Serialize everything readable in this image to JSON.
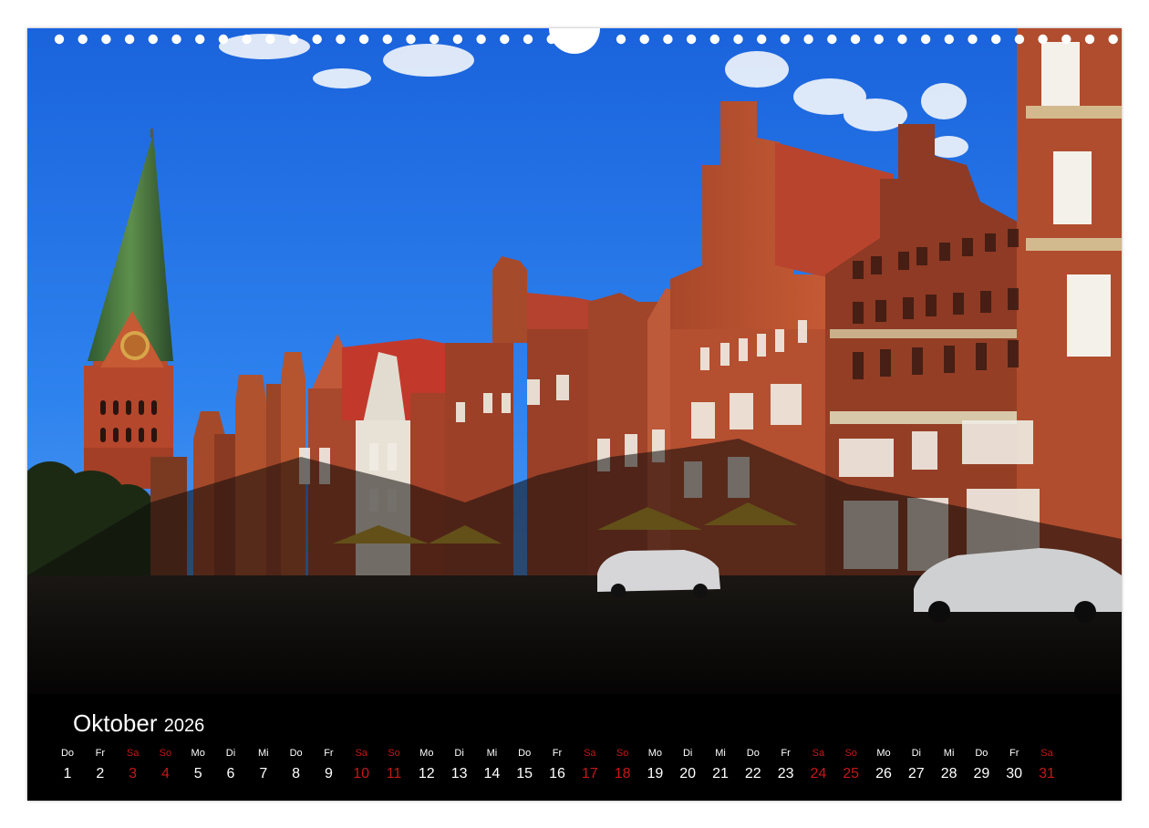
{
  "calendar": {
    "month": "Oktober",
    "year": "2026",
    "weekend_color": "#c51818",
    "days": [
      {
        "name": "Do",
        "num": "1",
        "weekend": false
      },
      {
        "name": "Fr",
        "num": "2",
        "weekend": false
      },
      {
        "name": "Sa",
        "num": "3",
        "weekend": true
      },
      {
        "name": "So",
        "num": "4",
        "weekend": true
      },
      {
        "name": "Mo",
        "num": "5",
        "weekend": false
      },
      {
        "name": "Di",
        "num": "6",
        "weekend": false
      },
      {
        "name": "Mi",
        "num": "7",
        "weekend": false
      },
      {
        "name": "Do",
        "num": "8",
        "weekend": false
      },
      {
        "name": "Fr",
        "num": "9",
        "weekend": false
      },
      {
        "name": "Sa",
        "num": "10",
        "weekend": true
      },
      {
        "name": "So",
        "num": "11",
        "weekend": true
      },
      {
        "name": "Mo",
        "num": "12",
        "weekend": false
      },
      {
        "name": "Di",
        "num": "13",
        "weekend": false
      },
      {
        "name": "Mi",
        "num": "14",
        "weekend": false
      },
      {
        "name": "Do",
        "num": "15",
        "weekend": false
      },
      {
        "name": "Fr",
        "num": "16",
        "weekend": false
      },
      {
        "name": "Sa",
        "num": "17",
        "weekend": true
      },
      {
        "name": "So",
        "num": "18",
        "weekend": true
      },
      {
        "name": "Mo",
        "num": "19",
        "weekend": false
      },
      {
        "name": "Di",
        "num": "20",
        "weekend": false
      },
      {
        "name": "Mi",
        "num": "21",
        "weekend": false
      },
      {
        "name": "Do",
        "num": "22",
        "weekend": false
      },
      {
        "name": "Fr",
        "num": "23",
        "weekend": false
      },
      {
        "name": "Sa",
        "num": "24",
        "weekend": true
      },
      {
        "name": "So",
        "num": "25",
        "weekend": true
      },
      {
        "name": "Mo",
        "num": "26",
        "weekend": false
      },
      {
        "name": "Di",
        "num": "27",
        "weekend": false
      },
      {
        "name": "Mi",
        "num": "28",
        "weekend": false
      },
      {
        "name": "Do",
        "num": "29",
        "weekend": false
      },
      {
        "name": "Fr",
        "num": "30",
        "weekend": false
      },
      {
        "name": "Sa",
        "num": "31",
        "weekend": true
      }
    ]
  }
}
